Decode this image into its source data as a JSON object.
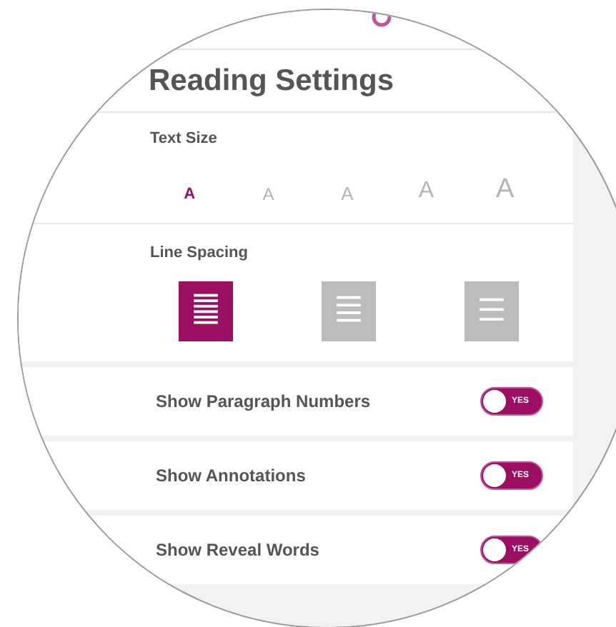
{
  "title": "Reading Settings",
  "text_size": {
    "label": "Text Size",
    "options": [
      {
        "glyph": "A",
        "selected": true
      },
      {
        "glyph": "A",
        "selected": false
      },
      {
        "glyph": "A",
        "selected": false
      },
      {
        "glyph": "A",
        "selected": false
      },
      {
        "glyph": "A",
        "selected": false
      }
    ]
  },
  "line_spacing": {
    "label": "Line Spacing",
    "options": [
      {
        "kind": "tight",
        "selected": true
      },
      {
        "kind": "normal",
        "selected": false
      },
      {
        "kind": "loose",
        "selected": false
      }
    ]
  },
  "toggles": [
    {
      "label": "Show Paragraph Numbers",
      "toggle_text": "YES",
      "on": true
    },
    {
      "label": "Show Annotations",
      "toggle_text": "YES",
      "on": true
    },
    {
      "label": "Show Reveal Words",
      "toggle_text": "YES",
      "on": true
    }
  ]
}
